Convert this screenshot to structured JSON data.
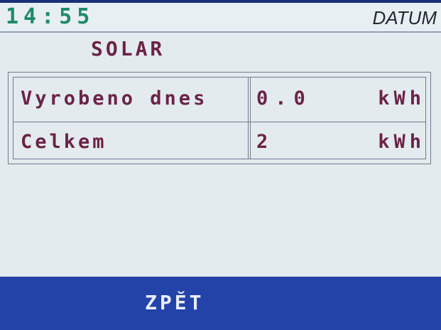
{
  "header": {
    "time": "14:55",
    "datum_label": "DATUM"
  },
  "page": {
    "title": "SOLAR"
  },
  "table": {
    "rows": [
      {
        "label": "Vyrobeno dnes",
        "value": "0.0",
        "unit": "kWh"
      },
      {
        "label": "Celkem",
        "value": "2",
        "unit": "kWh"
      }
    ]
  },
  "footer": {
    "back_label": "ZPĚT"
  },
  "colors": {
    "header_bar": "#e8eff3",
    "time_text": "#1e8a6a",
    "value_text": "#6b2346",
    "footer_bar": "#2343a8",
    "screen_bg": "#e3ebef"
  }
}
